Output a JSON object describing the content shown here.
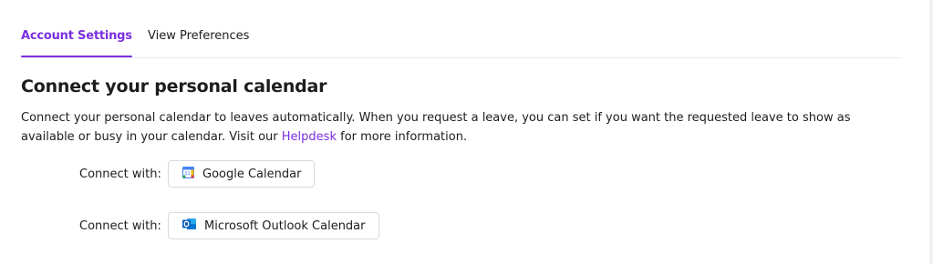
{
  "tabs": [
    {
      "label": "Account Settings",
      "active": true
    },
    {
      "label": "View Preferences",
      "active": false
    }
  ],
  "section": {
    "title": "Connect your personal calendar",
    "description_before_link": "Connect your personal calendar to leaves automatically. When you request a leave, you can set if you want the requested leave to show as available or busy in your calendar. Visit our ",
    "link_text": "Helpdesk",
    "description_after_link": " for more information."
  },
  "connections": [
    {
      "label": "Connect with:",
      "button_label": "Google Calendar",
      "icon": "google-calendar-icon"
    },
    {
      "label": "Connect with:",
      "button_label": "Microsoft Outlook Calendar",
      "icon": "outlook-icon"
    }
  ],
  "colors": {
    "accent": "#7b2fe0",
    "text": "#1d1d1f",
    "divider": "#e8e8ec"
  }
}
